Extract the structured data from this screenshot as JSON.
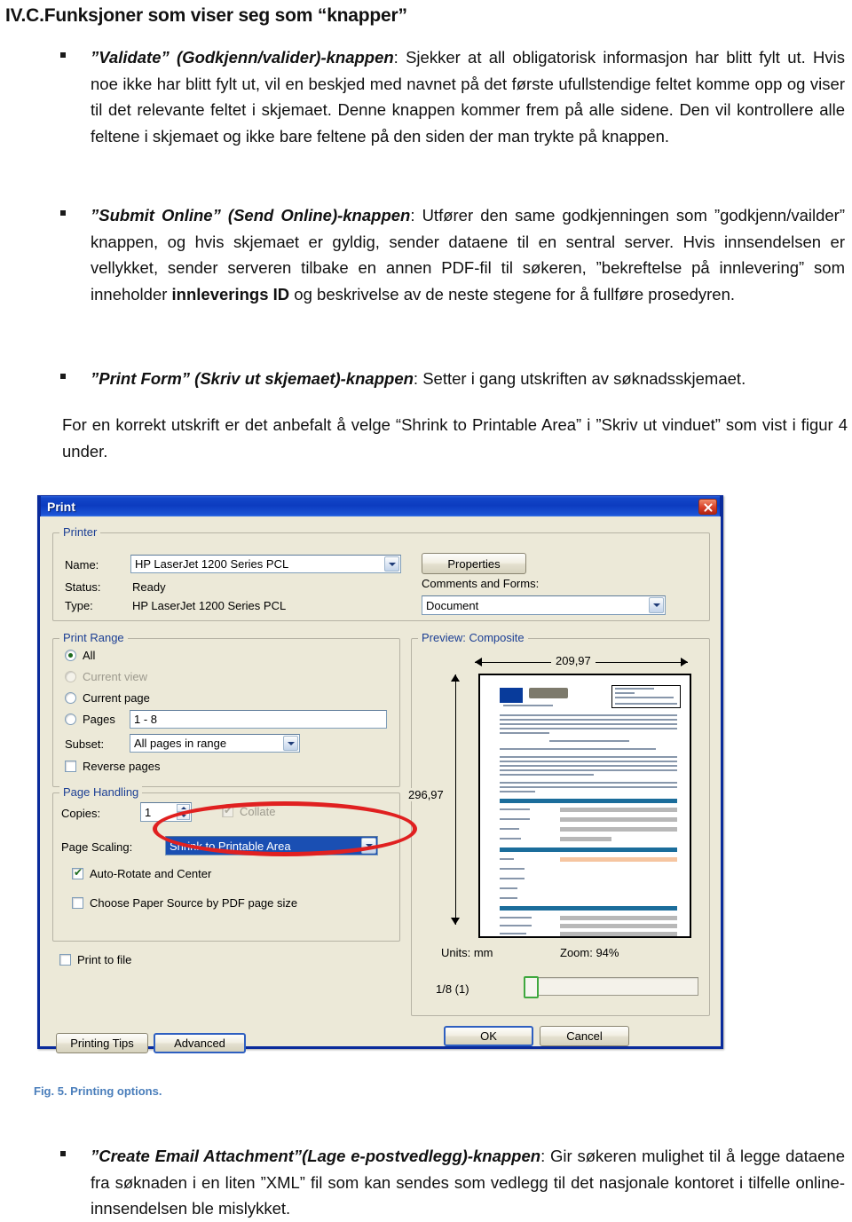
{
  "document": {
    "heading": "IV.C.Funksjoner som viser seg som “knapper”",
    "bullets": [
      {
        "term": "”Validate” (Godkjenn/valider)-knappen",
        "body": ": Sjekker at all obligatorisk informasjon har blitt fylt ut. Hvis noe ikke har blitt fylt ut, vil en beskjed med navnet på det første ufullstendige feltet komme opp og viser til det relevante feltet i skjemaet. Denne knappen kommer frem på alle sidene. Den vil kontrollere alle feltene i skjemaet og ikke bare feltene på den siden der man trykte på knappen."
      },
      {
        "term": "”Submit Online” (Send Online)-knappen",
        "body": ": Utfører den same godkjenningen som ”godkjenn/vailder” knappen, og hvis skjemaet er gyldig, sender dataene til en sentral server. Hvis innsendelsen er vellykket, sender serveren tilbake en annen PDF-fil til søkeren, ”bekreftelse på innlevering” som inneholder ",
        "bold_mid": "innleverings ID",
        "body2": " og beskrivelse av de neste stegene for å fullføre prosedyren."
      },
      {
        "term": "”Print Form” (Skriv ut skjemaet)-knappen",
        "body": ": Setter i gang utskriften av søknadsskjemaet."
      },
      {
        "term": "”Create Email Attachment”(Lage e-postvedlegg)-knappen",
        "body": ": Gir søkeren mulighet til å legge dataene fra søknaden i en liten ”XML” fil som kan sendes som vedlegg til det nasjonale kontoret i tilfelle online-innsendelsen ble mislykket."
      }
    ],
    "note_paragraph": "For en korrekt utskrift er det anbefalt å velge “Shrink to Printable Area” i ”Skriv ut vinduet” som vist i figur 4 under.",
    "figure_caption": "Fig. 5. Printing options."
  },
  "print_dialog": {
    "title": "Print",
    "close_icon": "close-icon",
    "printer_group": {
      "legend": "Printer",
      "name_label": "Name:",
      "name_value": "HP LaserJet 1200 Series PCL",
      "status_label": "Status:",
      "status_value": "Ready",
      "type_label": "Type:",
      "type_value": "HP LaserJet 1200 Series PCL",
      "properties_button": "Properties",
      "comments_label": "Comments and Forms:",
      "comments_value": "Document"
    },
    "print_range_group": {
      "legend": "Print Range",
      "options": [
        {
          "label": "All",
          "selected": true,
          "disabled": false
        },
        {
          "label": "Current view",
          "selected": false,
          "disabled": true
        },
        {
          "label": "Current page",
          "selected": false,
          "disabled": false
        },
        {
          "label": "Pages",
          "selected": false,
          "disabled": false
        }
      ],
      "pages_value": "1 - 8",
      "subset_label": "Subset:",
      "subset_value": "All pages in range",
      "reverse_pages_label": "Reverse pages",
      "reverse_pages_checked": false
    },
    "page_handling_group": {
      "legend": "Page Handling",
      "copies_label": "Copies:",
      "copies_value": "1",
      "collate_label": "Collate",
      "collate_checked": true,
      "collate_disabled": true,
      "page_scaling_label": "Page Scaling:",
      "page_scaling_value": "Shrink to Printable Area",
      "auto_rotate_label": "Auto-Rotate and Center",
      "auto_rotate_checked": true,
      "choose_paper_label": "Choose Paper Source by PDF page size",
      "choose_paper_checked": false
    },
    "print_to_file_label": "Print to file",
    "print_to_file_checked": false,
    "preview_group": {
      "legend": "Preview: Composite",
      "width_mm": "209,97",
      "height_mm": "296,97",
      "units_label": "Units: mm",
      "zoom_label": "Zoom:  94%",
      "page_indicator": "1/8 (1)"
    },
    "buttons": {
      "printing_tips": "Printing Tips",
      "advanced": "Advanced",
      "ok": "OK",
      "cancel": "Cancel"
    },
    "colors": {
      "titlebar": "#0c3cc0",
      "dialog_face": "#ece9d8",
      "legend_text": "#1c3f94",
      "selection": "#1a4fb3",
      "annotation": "#e02020",
      "caption": "#4a7ebb"
    }
  }
}
